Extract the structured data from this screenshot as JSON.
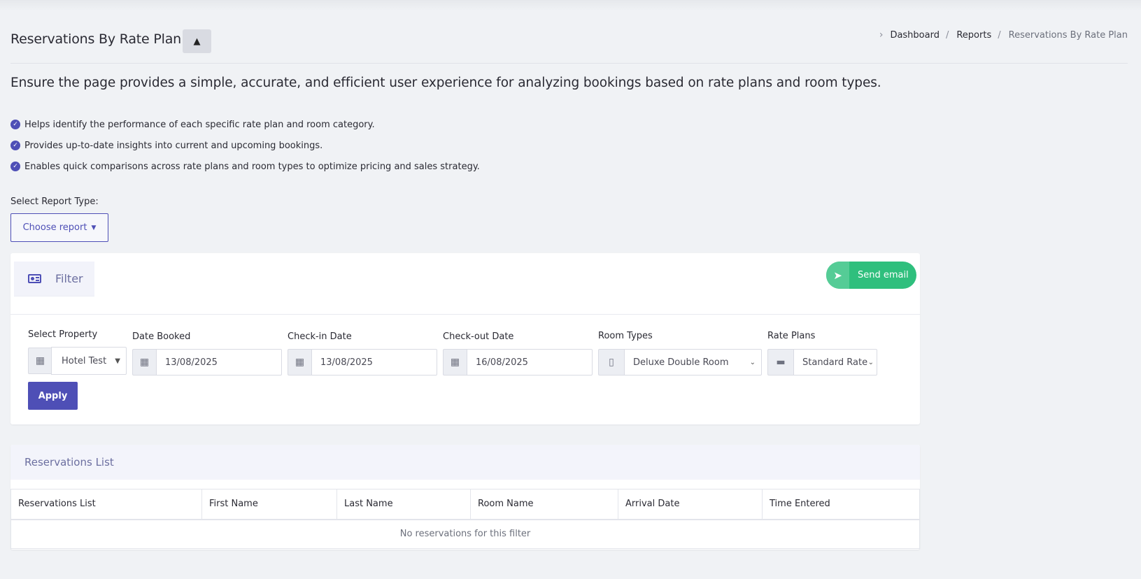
{
  "page": {
    "title": "Reservations By Rate Plan",
    "collapse_symbol": "▲"
  },
  "breadcrumb": {
    "items": [
      "Dashboard",
      "Reports",
      "Reservations By Rate Plan"
    ]
  },
  "intro": {
    "headline": "Ensure the page provides a simple, accurate, and efficient user experience for analyzing bookings based on rate plans and room types.",
    "bullets": [
      "Helps identify the performance of each specific rate plan and room category.",
      "Provides up-to-date insights into current and upcoming bookings.",
      "Enables quick comparisons across rate plans and room types to optimize pricing and sales strategy."
    ]
  },
  "report_type": {
    "label": "Select Report Type:",
    "button": "Choose report"
  },
  "filter": {
    "tab_label": "Filter",
    "send_email": "Send email",
    "property": {
      "label": "Select Property",
      "value": "Hotel Test"
    },
    "date_booked": {
      "label": "Date Booked",
      "value": "13/08/2025"
    },
    "check_in": {
      "label": "Check-in Date",
      "value": "13/08/2025"
    },
    "check_out": {
      "label": "Check-out Date",
      "value": "16/08/2025"
    },
    "room_types": {
      "label": "Room Types",
      "value": "Deluxe Double Room"
    },
    "rate_plans": {
      "label": "Rate Plans",
      "value": "Standard Rate"
    },
    "apply": "Apply"
  },
  "reservations": {
    "title": "Reservations List",
    "columns": [
      "Reservations List",
      "First Name",
      "Last Name",
      "Room Name",
      "Arrival Date",
      "Time Entered"
    ],
    "empty_message": "No reservations for this filter"
  },
  "colors": {
    "accent": "#4e4fb6",
    "success": "#2fbf7d",
    "background": "#f0f2f5"
  }
}
